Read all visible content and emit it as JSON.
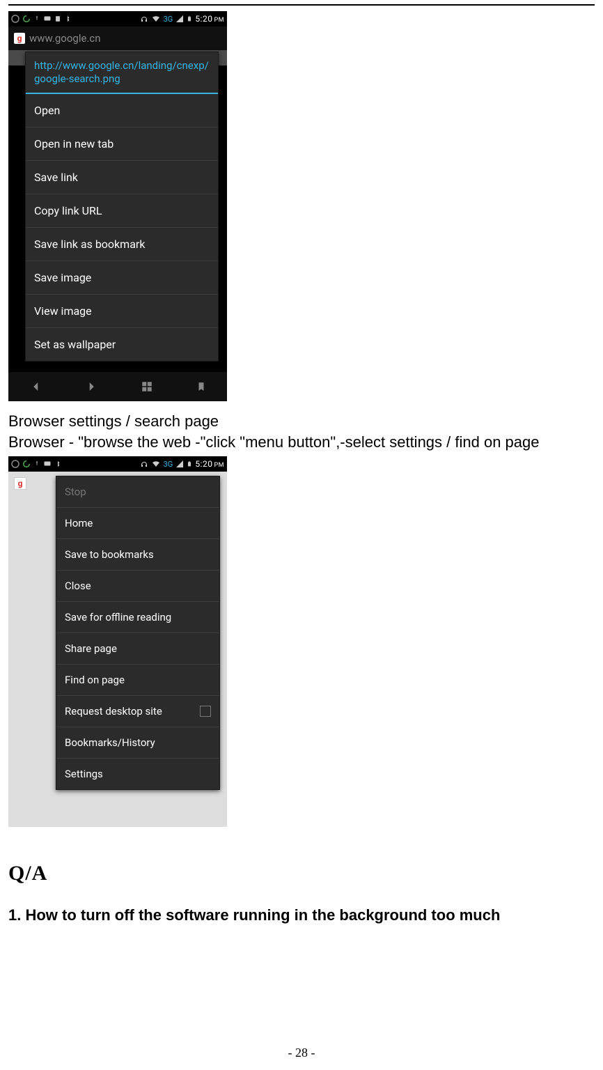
{
  "status_time": "5:20",
  "status_ampm": "PM",
  "status_net": "3G",
  "screenshot1": {
    "url_blur": "www.google.cn",
    "ctx_header": "http://www.google.cn/landing/cnexp/google-search.png",
    "items": {
      "open": "Open",
      "open_new_tab": "Open in new tab",
      "save_link": "Save link",
      "copy_link": "Copy link URL",
      "save_bookmark": "Save link as bookmark",
      "save_image": "Save image",
      "view_image": "View image",
      "set_wallpaper": "Set as wallpaper"
    }
  },
  "doc": {
    "line1": "Browser settings / search page",
    "line2": "Browser - \"browse the web -\"click \"menu button\",-select settings / find on page"
  },
  "screenshot2": {
    "items": {
      "stop": "Stop",
      "home": "Home",
      "save_bookmarks": "Save to bookmarks",
      "close": "Close",
      "save_offline": "Save for offline reading",
      "share_page": "Share page",
      "find_on_page": "Find on page",
      "request_desktop": "Request desktop site",
      "bookmarks_history": "Bookmarks/History",
      "settings": "Settings"
    }
  },
  "qa": {
    "heading": "Q/A",
    "q1": "1. How to turn off the software running in the background too much"
  },
  "page_number": "- 28 -"
}
